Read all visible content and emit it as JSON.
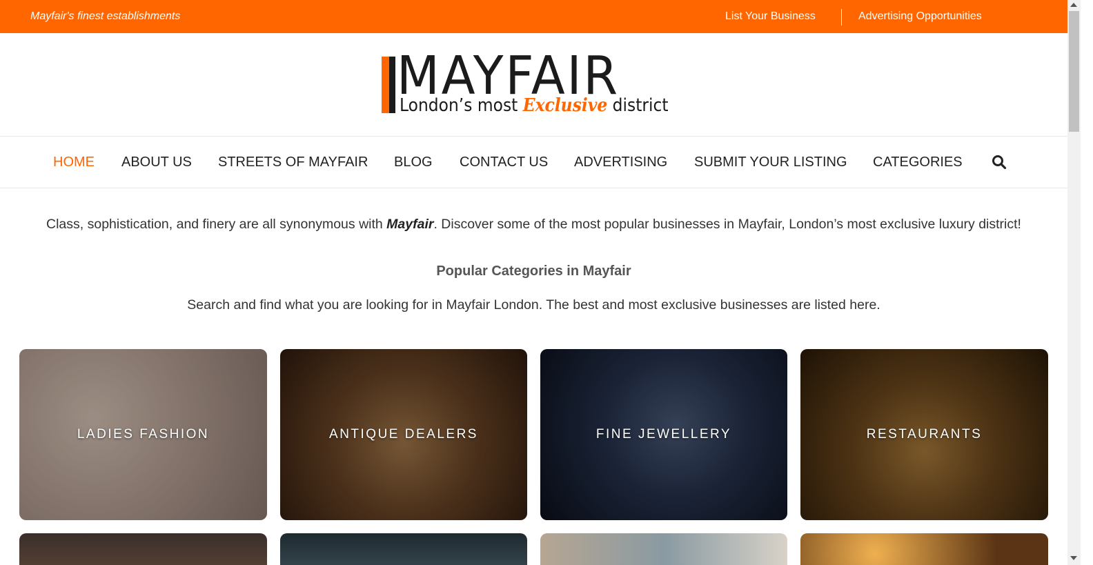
{
  "topbar": {
    "tagline": "Mayfair's finest establishments",
    "links": [
      "List Your Business",
      "Advertising Opportunities"
    ],
    "color": "#ff6600"
  },
  "logo": {
    "word": "MAYFAIR",
    "sub_before": "London’s most",
    "sub_accent": "Exclusive",
    "sub_after": "district"
  },
  "nav": {
    "items": [
      "HOME",
      "ABOUT US",
      "STREETS OF MAYFAIR",
      "BLOG",
      "CONTACT US",
      "ADVERTISING",
      "SUBMIT YOUR LISTING",
      "CATEGORIES"
    ],
    "active": "HOME",
    "search_icon": "search-icon"
  },
  "intro": {
    "before": "Class, sophistication, and finery are all synonymous with ",
    "emphasis": "Mayfair",
    "after": ". Discover some of the most popular businesses in Mayfair, London’s most exclusive luxury district!"
  },
  "categories": {
    "title": "Popular Categories in Mayfair",
    "subtitle": "Search and find what you are looking for in Mayfair London. The best and most exclusive businesses are listed here.",
    "cards": [
      "LADIES FASHION",
      "ANTIQUE DEALERS",
      "FINE JEWELLERY",
      "RESTAURANTS"
    ]
  }
}
